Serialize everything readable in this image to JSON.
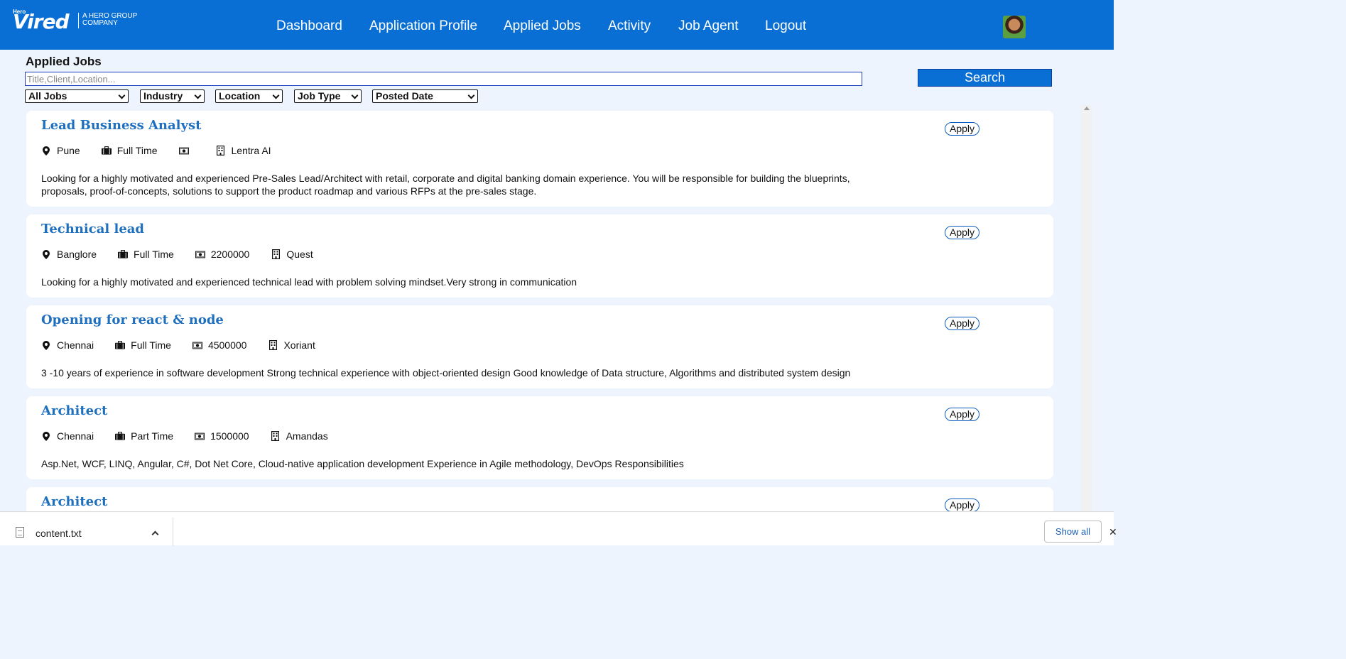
{
  "brand": {
    "hero_small": "Hero",
    "name": "Vired",
    "tagline": "A HERO GROUP COMPANY"
  },
  "nav": {
    "items": [
      "Dashboard",
      "Application Profile",
      "Applied Jobs",
      "Activity",
      "Job Agent",
      "Logout"
    ]
  },
  "page": {
    "title": "Applied Jobs"
  },
  "search": {
    "placeholder": "Title,Client,Location...",
    "value": "",
    "button_label": "Search"
  },
  "filters": [
    "All Jobs",
    "Industry",
    "Location",
    "Job Type",
    "Posted Date"
  ],
  "jobs": [
    {
      "title": "Lead Business Analyst",
      "location": "Pune",
      "job_type": "Full Time",
      "salary": "",
      "company": "Lentra AI",
      "description": "Looking for a highly motivated and experienced Pre-Sales Lead/Architect with retail, corporate and digital banking domain experience. You will be responsible for building the blueprints, proposals, proof-of-concepts, solutions to support the product roadmap and various RFPs at the pre-sales stage.",
      "apply_label": "Apply"
    },
    {
      "title": "Technical lead",
      "location": "Banglore",
      "job_type": "Full Time",
      "salary": "2200000",
      "company": "Quest",
      "description": "Looking for a highly motivated and experienced technical lead with problem solving mindset.Very strong in communication",
      "apply_label": "Apply"
    },
    {
      "title": "Opening for react & node",
      "location": "Chennai",
      "job_type": "Full Time",
      "salary": "4500000",
      "company": "Xoriant",
      "description": "3 -10 years of experience in software development Strong technical experience with object-oriented design Good knowledge of Data structure, Algorithms and distributed system design",
      "apply_label": "Apply"
    },
    {
      "title": "Architect",
      "location": "Chennai",
      "job_type": "Part Time",
      "salary": "1500000",
      "company": "Amandas",
      "description": "Asp.Net, WCF, LINQ, Angular, C#, Dot Net Core, Cloud-native application development Experience in Agile methodology, DevOps Responsibilities",
      "apply_label": "Apply"
    },
    {
      "title": "Architect",
      "apply_label": "Apply"
    }
  ],
  "downloads": {
    "file_name": "content.txt",
    "show_all_label": "Show all",
    "close_glyph": "✕"
  },
  "icons": {
    "location": "map-pin-icon",
    "job_type": "briefcase-icon",
    "salary": "money-icon",
    "company": "building-icon"
  }
}
